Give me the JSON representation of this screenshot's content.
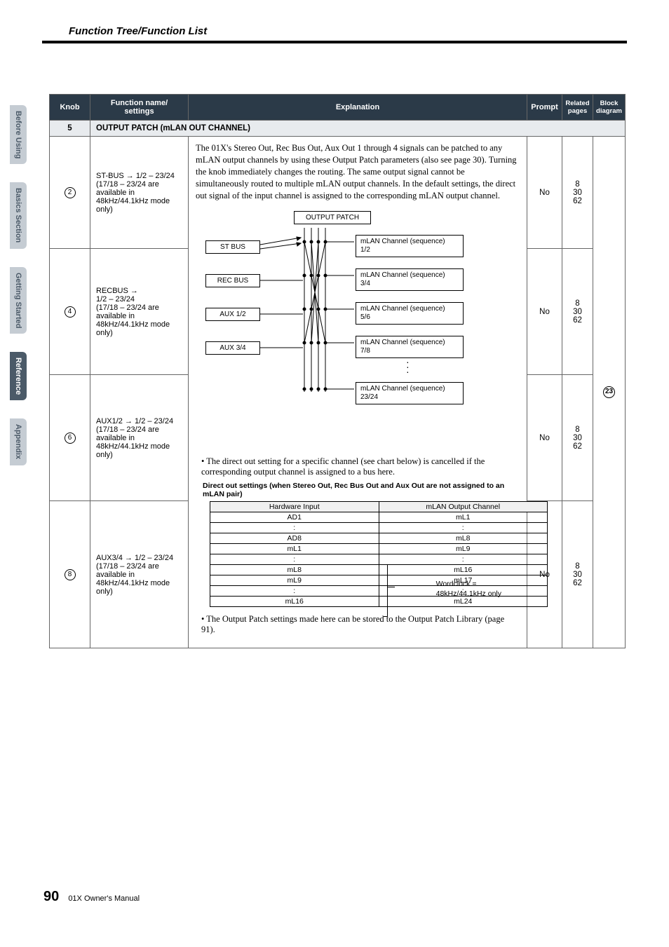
{
  "header": {
    "title": "Function Tree/Function List"
  },
  "tabs": {
    "before": "Before Using",
    "basics": "Basics Section",
    "getting": "Getting Started",
    "reference": "Reference",
    "appendix": "Appendix"
  },
  "table": {
    "headers": {
      "knob": "Knob",
      "func": "Function name/\nsettings",
      "expl": "Explanation",
      "prompt": "Prompt",
      "pages": "Related pages",
      "block": "Block diagram"
    },
    "section": {
      "num": "5",
      "title": "OUTPUT PATCH (mLAN OUT CHANNEL)"
    },
    "rows": [
      {
        "knob": "2",
        "func": "ST-BUS → 1/2 – 23/24\n(17/18 – 23/24 are available in 48kHz/44.1kHz mode only)",
        "prompt": "No",
        "pages": "8\n30\n62"
      },
      {
        "knob": "4",
        "func": "RECBUS →\n1/2 – 23/24\n(17/18 – 23/24 are available in 48kHz/44.1kHz mode only)",
        "prompt": "No",
        "pages": "8\n30\n62"
      },
      {
        "knob": "6",
        "func": "AUX1/2 → 1/2 – 23/24\n(17/18 – 23/24 are available in 48kHz/44.1kHz mode only)",
        "prompt": "No",
        "pages": "8\n30\n62"
      },
      {
        "knob": "8",
        "func": "AUX3/4 → 1/2 – 23/24\n(17/18 – 23/24 are available in 48kHz/44.1kHz mode only)",
        "prompt": "No",
        "pages": "8\n30\n62"
      }
    ],
    "block_diagram": "23"
  },
  "explanation": {
    "para1": "The 01X's Stereo Out, Rec Bus Out, Aux Out 1 through 4 signals can be patched to any mLAN output channels by using these Output Patch parameters (also see page 30).  Turning the knob immediately changes the routing.  The same output signal cannot be simultaneously routed to multiple mLAN output channels. In the default settings, the direct out signal of the input channel is assigned to the corresponding mLAN output channel.",
    "diagram": {
      "title": "OUTPUT PATCH",
      "left": {
        "st": "ST BUS",
        "rec": "REC BUS",
        "aux12": "AUX 1/2",
        "aux34": "AUX 3/4"
      },
      "right": {
        "r1a": "mLAN Channel (sequence)",
        "r1b": "1/2",
        "r2a": "mLAN Channel (sequence)",
        "r2b": "3/4",
        "r3a": "mLAN Channel (sequence)",
        "r3b": "5/6",
        "r4a": "mLAN Channel (sequence)",
        "r4b": "7/8",
        "r5a": "mLAN Channel (sequence)",
        "r5b": "23/24"
      }
    },
    "bullet1": "The direct out setting for a specific channel (see chart below) is cancelled if the corresponding output channel is assigned to a bus here.",
    "caption": "Direct out settings (when Stereo Out, Rec Bus Out and Aux Out are not assigned to an mLAN pair)",
    "inner": {
      "h1": "Hardware Input",
      "h2": "mLAN Output Channel",
      "rows": [
        [
          "AD1",
          "mL1"
        ],
        [
          ":",
          ":"
        ],
        [
          "AD8",
          "mL8"
        ],
        [
          "mL1",
          "mL9"
        ],
        [
          ":",
          ":"
        ],
        [
          "mL8",
          "mL16"
        ],
        [
          "mL9",
          "mL17"
        ],
        [
          ":",
          ":"
        ],
        [
          "mL16",
          "mL24"
        ]
      ]
    },
    "word_note1": "Wordclock =",
    "word_note2": "48kHz/44.1kHz only",
    "bullet2": "The Output Patch settings made here can be stored to the Output Patch Library (page 91)."
  },
  "footer": {
    "page": "90",
    "text": "01X  Owner's Manual"
  }
}
